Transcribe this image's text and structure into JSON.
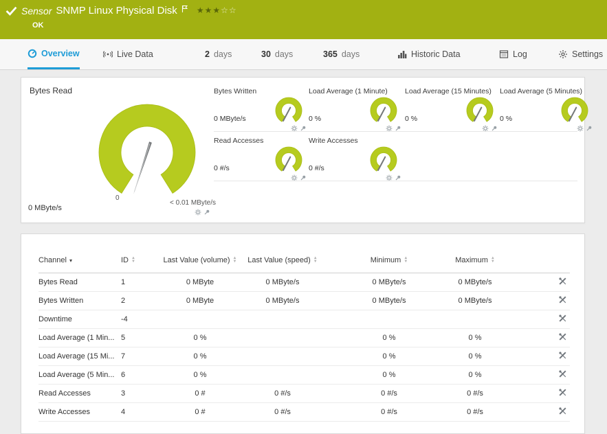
{
  "header": {
    "kind_label": "Sensor",
    "title": "SNMP Linux Physical Disk",
    "status": "OK",
    "rating": {
      "filled": "★★★",
      "empty": "☆☆"
    }
  },
  "tabs": {
    "overview": "Overview",
    "live_data": "Live Data",
    "d2_num": "2",
    "d2_word": "days",
    "d30_num": "30",
    "d30_word": "days",
    "d365_num": "365",
    "d365_word": "days",
    "historic": "Historic Data",
    "log": "Log",
    "settings": "Settings"
  },
  "gauges": {
    "main": {
      "label": "Bytes Read",
      "value": "0 MByte/s",
      "scale_min": "0",
      "scale_max": "< 0.01 MByte/s"
    },
    "small": [
      {
        "label": "Bytes Written",
        "value": "0 MByte/s"
      },
      {
        "label": "Load Average (1 Minute)",
        "value": "0 %"
      },
      {
        "label": "Load Average (15 Minutes)",
        "value": "0 %"
      },
      {
        "label": "Load Average (5 Minutes)",
        "value": "0 %"
      },
      {
        "label": "Read Accesses",
        "value": "0 #/s"
      },
      {
        "label": "Write Accesses",
        "value": "0 #/s"
      }
    ]
  },
  "table": {
    "headers": {
      "channel": "Channel",
      "id": "ID",
      "volume": "Last Value (volume)",
      "speed": "Last Value (speed)",
      "min": "Minimum",
      "max": "Maximum"
    },
    "rows": [
      {
        "channel": "Bytes Read",
        "id": "1",
        "volume": "0 MByte",
        "speed": "0 MByte/s",
        "min": "0 MByte/s",
        "max": "0 MByte/s"
      },
      {
        "channel": "Bytes Written",
        "id": "2",
        "volume": "0 MByte",
        "speed": "0 MByte/s",
        "min": "0 MByte/s",
        "max": "0 MByte/s"
      },
      {
        "channel": "Downtime",
        "id": "-4",
        "volume": "",
        "speed": "",
        "min": "",
        "max": ""
      },
      {
        "channel": "Load Average (1 Min...",
        "id": "5",
        "volume": "0 %",
        "speed": "",
        "min": "0 %",
        "max": "0 %"
      },
      {
        "channel": "Load Average (15 Mi...",
        "id": "7",
        "volume": "0 %",
        "speed": "",
        "min": "0 %",
        "max": "0 %"
      },
      {
        "channel": "Load Average (5 Min...",
        "id": "6",
        "volume": "0 %",
        "speed": "",
        "min": "0 %",
        "max": "0 %"
      },
      {
        "channel": "Read Accesses",
        "id": "3",
        "volume": "0 #",
        "speed": "0 #/s",
        "min": "0 #/s",
        "max": "0 #/s"
      },
      {
        "channel": "Write Accesses",
        "id": "4",
        "volume": "0 #",
        "speed": "0 #/s",
        "min": "0 #/s",
        "max": "0 #/s"
      }
    ]
  },
  "colors": {
    "header_green": "#a2b112",
    "gauge_green": "#b6cb1f",
    "accent_blue": "#1e9cd7"
  }
}
